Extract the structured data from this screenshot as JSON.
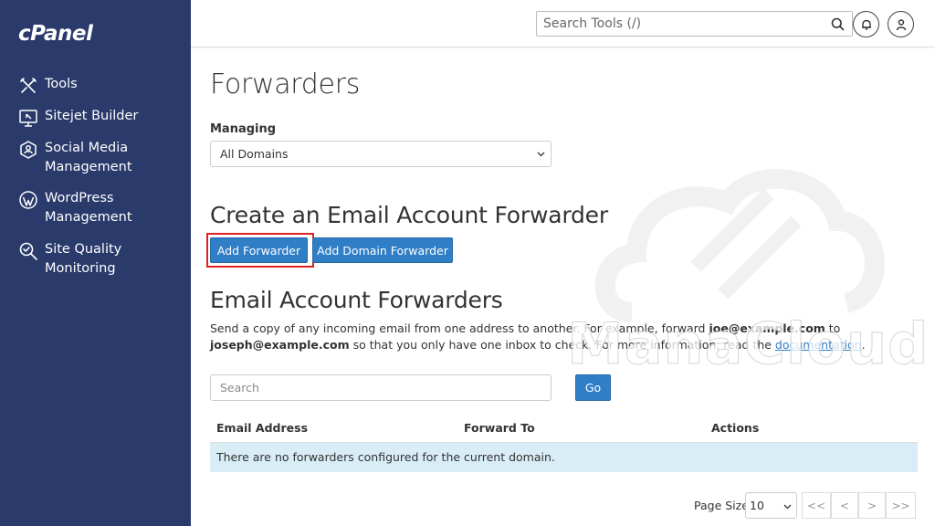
{
  "app": {
    "logo": "cPanel"
  },
  "sidebar": {
    "items": [
      {
        "label": "Tools",
        "icon": "tools-icon"
      },
      {
        "label": "Sitejet Builder",
        "icon": "sitejet-icon"
      },
      {
        "label": "Social Media\nManagement",
        "icon": "social-media-icon"
      },
      {
        "label": "WordPress\nManagement",
        "icon": "wordpress-icon"
      },
      {
        "label": "Site Quality\nMonitoring",
        "icon": "site-quality-icon"
      }
    ]
  },
  "header": {
    "search_placeholder": "Search Tools (/)"
  },
  "main": {
    "title": "Forwarders",
    "managing_label": "Managing",
    "managing_value": "All Domains",
    "create_heading": "Create an Email Account Forwarder",
    "add_forwarder_label": "Add Forwarder",
    "add_domain_forwarder_label": "Add Domain Forwarder",
    "list_heading": "Email Account Forwarders",
    "description": {
      "part1": "Send a copy of any incoming email from one address to another. For example, forward ",
      "email1": "joe@example.com",
      "part2": " to ",
      "email2": "joseph@example.com",
      "part3": " so that you only have one inbox to check. For more information, read the ",
      "link": "documentation",
      "part4": "."
    },
    "search_placeholder": "Search",
    "go_label": "Go",
    "table": {
      "columns": [
        "Email Address",
        "Forward To",
        "Actions"
      ],
      "empty_message": "There are no forwarders configured for the current domain."
    },
    "pagination": {
      "page_size_label": "Page Size",
      "page_size_value": "10",
      "buttons": [
        "<<",
        "<",
        ">",
        ">>"
      ]
    }
  },
  "watermark": {
    "text": "ManaCloud"
  },
  "colors": {
    "sidebar_bg": "#293a6b",
    "primary_button": "#2f7ec6",
    "highlight": "#e02020",
    "empty_row_bg": "#d9edf7"
  }
}
